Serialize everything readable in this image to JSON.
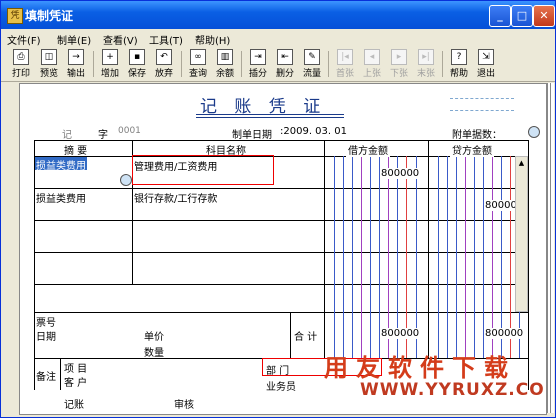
{
  "window": {
    "title": "填制凭证"
  },
  "menu": [
    {
      "label": "文件(F)"
    },
    {
      "label": "制单(E)"
    },
    {
      "label": "查看(V)"
    },
    {
      "label": "工具(T)"
    },
    {
      "label": "帮助(H)"
    }
  ],
  "toolbar": [
    {
      "label": "打印",
      "icon": "printer-icon"
    },
    {
      "label": "预览",
      "icon": "preview-icon"
    },
    {
      "label": "输出",
      "icon": "export-icon"
    },
    {
      "label": "增加",
      "icon": "add-icon"
    },
    {
      "label": "保存",
      "icon": "save-icon"
    },
    {
      "label": "放弃",
      "icon": "undo-icon"
    },
    {
      "label": "查询",
      "icon": "binoculars-icon"
    },
    {
      "label": "余额",
      "icon": "balance-chart-icon"
    },
    {
      "label": "插分",
      "icon": "insert-row-icon"
    },
    {
      "label": "删分",
      "icon": "delete-row-icon"
    },
    {
      "label": "流量",
      "icon": "cashflow-icon"
    },
    {
      "label": "首张",
      "icon": "first-icon"
    },
    {
      "label": "上张",
      "icon": "prev-icon"
    },
    {
      "label": "下张",
      "icon": "next-icon"
    },
    {
      "label": "末张",
      "icon": "last-icon"
    },
    {
      "label": "帮助",
      "icon": "help-icon"
    },
    {
      "label": "退出",
      "icon": "exit-icon"
    }
  ],
  "voucher": {
    "title": "记 账 凭 证",
    "type_label": "记",
    "zi_label": "字",
    "number": "0001",
    "date_label": "制单日期",
    "date": ":2009. 03. 01",
    "attachments_label": "附单据数：",
    "headers": {
      "summary": "摘 要",
      "account": "科目名称",
      "debit": "借方金额",
      "credit": "贷方金额"
    },
    "rows": [
      {
        "summary": "损益类费用",
        "account": "管理费用/工资费用",
        "debit": "800000",
        "credit": ""
      },
      {
        "summary": "损益类费用",
        "account": "银行存款/工行存款",
        "debit": "",
        "credit": "800000"
      }
    ],
    "footer": {
      "ticket_no": "票号",
      "date": "日期",
      "unit_price": "单价",
      "quantity": "数量",
      "total_label": "合 计",
      "total_debit": "800000",
      "total_credit": "800000",
      "remark": "备注",
      "project": "项 目",
      "customer": "客 户",
      "department": "部 门",
      "salesman": "业务员",
      "bookkeeping": "记账",
      "review": "审核"
    }
  },
  "watermark": {
    "text": "用友软件下载",
    "url": "WWW.YYRUXZ.COM"
  }
}
